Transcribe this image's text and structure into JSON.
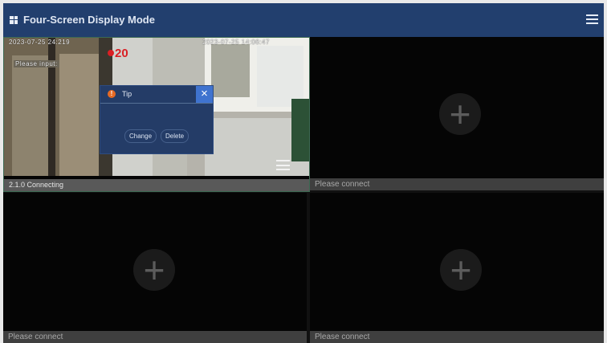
{
  "header": {
    "title": "Four-Screen Display Mode",
    "layout_icon": "four-grid-icon",
    "menu_icon": "hamburger-menu-icon"
  },
  "panes": {
    "camera": {
      "overlay_left": "2023-07-25 24:219",
      "overlay_right": "2023-07-25 14:06:47",
      "input_prompt": "Please input:",
      "status_text": "2.1.0 Connecting",
      "menu_icon": "hamburger-menu-icon"
    },
    "empty": [
      {
        "status": "Please connect"
      },
      {
        "status": "Please connect"
      },
      {
        "status": "Please connect"
      }
    ]
  },
  "dialog": {
    "title": "Tip",
    "warning_icon": "warning-icon",
    "close_label": "×",
    "buttons": [
      "Change",
      "Delete"
    ]
  },
  "colors": {
    "topbar": "#223f6e",
    "dialog": "#243c67",
    "dialog_close": "#3f73cf",
    "empty_pane": "#050505"
  }
}
